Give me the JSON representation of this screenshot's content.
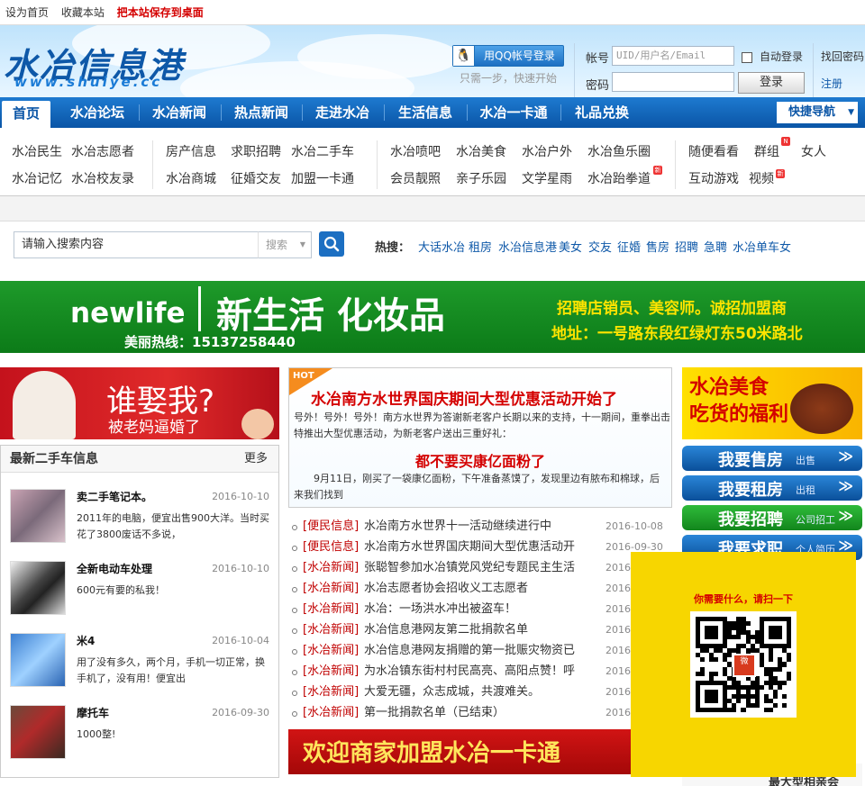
{
  "topbar": {
    "set_home": "设为首页",
    "bookmark": "收藏本站",
    "save_desktop": "把本站保存到桌面"
  },
  "header": {
    "logo_text": "水冶信息港",
    "logo_url_text": "www.shuiye.cc",
    "qq_login": "用QQ帐号登录",
    "qq_tip": "只需一步，快速开始",
    "account_label": "帐号",
    "account_placeholder": "UID/用户名/Email",
    "password_label": "密码",
    "auto_login": "自动登录",
    "login_button": "登录",
    "forgot": "找回密码",
    "register": "注册"
  },
  "nav": {
    "items": [
      "首页",
      "水冶论坛",
      "水冶新闻",
      "热点新闻",
      "走进水冶",
      "生活信息",
      "水冶一卡通",
      "礼品兑换"
    ],
    "quick_nav": "快捷导航"
  },
  "subnav": {
    "group1": [
      "水冶民生",
      "水冶志愿者",
      "水冶记忆",
      "水冶校友录"
    ],
    "group2": [
      "房产信息",
      "求职招聘",
      "水冶二手车",
      "水冶商城",
      "征婚交友",
      "加盟一卡通"
    ],
    "group3": [
      "水冶喷吧",
      "水冶美食",
      "水冶户外",
      "水冶鱼乐圈",
      "会员靓照",
      "亲子乐园",
      "文学星雨",
      "水冶跆拳道"
    ],
    "group4": [
      "随便看看",
      "群组",
      "女人",
      "互动游戏",
      "视频"
    ]
  },
  "search": {
    "placeholder": "请输入搜索内容",
    "select_value": "搜索",
    "hot_label": "热搜：",
    "hot_words": [
      "大话水冶",
      "租房",
      "水冶信息港",
      "美女",
      "交友",
      "征婚",
      "售房",
      "招聘",
      "急聘",
      "水冶单车女"
    ]
  },
  "banner": {
    "brand": "newlife",
    "title": "新生活 化妆品",
    "phone": "美丽热线：15137258440",
    "line1": "招聘店销员、美容师。诚招加盟商",
    "line2": "地址：一号路东段红绿灯东50米路北"
  },
  "left_ad": {
    "line1": "谁娶我?",
    "line2": "被老妈逼婚了"
  },
  "secondhand": {
    "title": "最新二手车信息",
    "more": "更多",
    "items": [
      {
        "title": "卖二手笔记本。",
        "date": "2016-10-10",
        "desc": "2011年的电脑，便宜出售900大洋。当时买花了3800废话不多说，"
      },
      {
        "title": "全新电动车处理",
        "date": "2016-10-10",
        "desc": "600元有要的私我！"
      },
      {
        "title": "米4",
        "date": "2016-10-04",
        "desc": "用了没有多久，两个月，手机一切正常，换手机了，没有用！便宜出"
      },
      {
        "title": "摩托车",
        "date": "2016-09-30",
        "desc": "1000整!"
      }
    ]
  },
  "headline": {
    "tag": "HOT",
    "title": "水冶南方水世界国庆期间大型优惠活动开始了",
    "desc": "号外！号外！号外！南方水世界为答谢新老客户长期以来的支持，十一期间，重拳出击特推出大型优惠活动，为新老客户送出三重好礼：",
    "title2": "都不要买康亿面粉了",
    "desc2": "9月11日，刚买了一袋康亿面粉，下午准备蒸馍了，发现里边有脓布和棉球，后来我们找到"
  },
  "news": [
    {
      "cat": "[便民信息]",
      "title": "水冶南方水世界十一活动继续进行中",
      "date": "2016-10-08"
    },
    {
      "cat": "[便民信息]",
      "title": "水冶南方水世界国庆期间大型优惠活动开",
      "date": "2016-09-30"
    },
    {
      "cat": "[水冶新闻]",
      "title": "张聪智参加水冶镇党风党纪专题民主生活",
      "date": "2016"
    },
    {
      "cat": "[水冶新闻]",
      "title": "水冶志愿者协会招收义工志愿者",
      "date": "2016"
    },
    {
      "cat": "[水冶新闻]",
      "title": "水冶：一场洪水冲出被盗车！",
      "date": "2016"
    },
    {
      "cat": "[水冶新闻]",
      "title": "水冶信息港网友第二批捐款名单",
      "date": "2016"
    },
    {
      "cat": "[水冶新闻]",
      "title": "水冶信息港网友捐赠的第一批赈灾物资已",
      "date": "2016"
    },
    {
      "cat": "[水冶新闻]",
      "title": "为水冶镇东街村村民高亮、高阳点赞！呼",
      "date": "2016"
    },
    {
      "cat": "[水冶新闻]",
      "title": "大爱无疆，众志成城，共渡难关。",
      "date": "2016"
    },
    {
      "cat": "[水冶新闻]",
      "title": "第一批捐款名单（已结束）",
      "date": "2016"
    }
  ],
  "join_ad": "欢迎商家加盟水冶一卡通",
  "right": {
    "food_line1": "水冶美食",
    "food_line2": "吃货的福利",
    "buttons": [
      {
        "big": "我要售房",
        "small": "出售",
        "color": "blue"
      },
      {
        "big": "我要租房",
        "small": "出租",
        "color": "blue"
      },
      {
        "big": "我要招聘",
        "small": "公司招工",
        "color": "green"
      },
      {
        "big": "我要求职",
        "small": "个人简历",
        "color": "blue"
      }
    ],
    "bottom_text": "最大型相亲会"
  },
  "qr": {
    "prompt": "你需要什么，请扫一下",
    "logo_text": "微"
  },
  "colors": {
    "nav_blue": "#0a55a6",
    "accent_red": "#d40000",
    "link_blue": "#0e58a8",
    "banner_green": "#0c7b18",
    "qr_yellow": "#f7d600"
  }
}
